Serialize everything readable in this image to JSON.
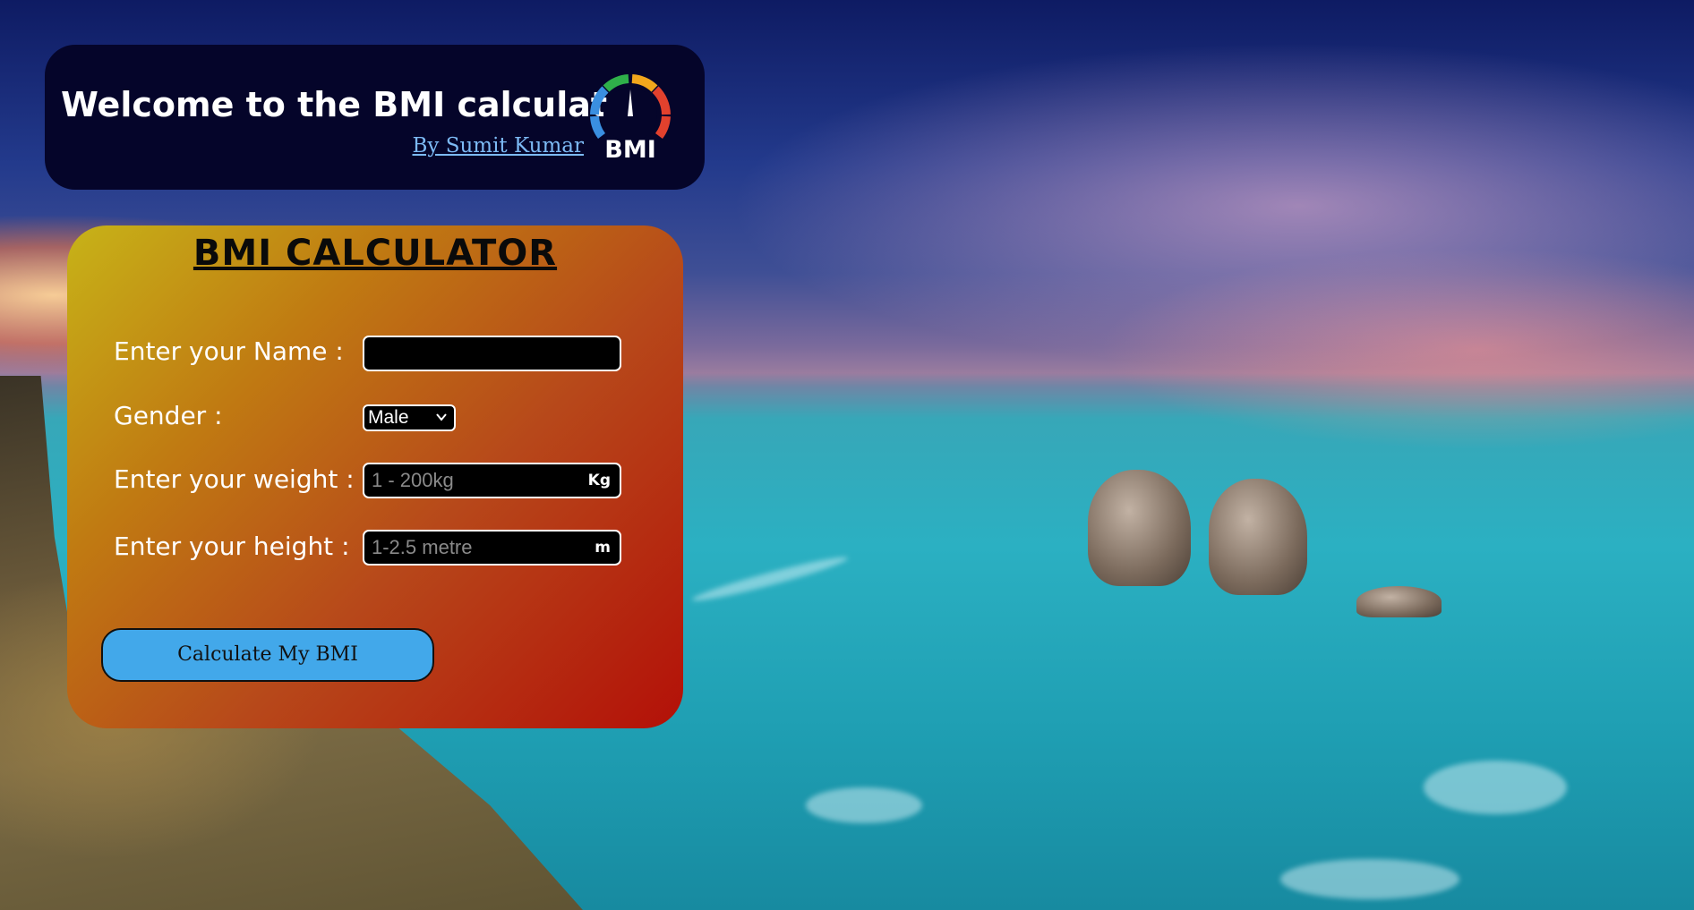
{
  "header": {
    "title": "Welcome to the BMI calculator",
    "author_link": "By Sumit Kumar",
    "logo_text": "BMI"
  },
  "calculator": {
    "title": "BMI CALCULATOR",
    "name": {
      "label": "Enter your Name :",
      "value": "",
      "placeholder": ""
    },
    "gender": {
      "label": "Gender :",
      "selected": "Male"
    },
    "weight": {
      "label": "Enter your weight :",
      "placeholder": "1 - 200kg",
      "unit": "Kg"
    },
    "height": {
      "label": "Enter your height :",
      "placeholder": "1-2.5 metre",
      "unit": "m"
    },
    "button_label": "Calculate My BMI"
  },
  "colors": {
    "header_bg": "#05052a",
    "link": "#7dbaf5",
    "button": "#42a8ea",
    "card_gradient_start": "#c7b318",
    "card_gradient_end": "#b31008"
  },
  "icons": {
    "logo": "bmi-gauge-icon",
    "dropdown": "chevron-down-icon"
  }
}
